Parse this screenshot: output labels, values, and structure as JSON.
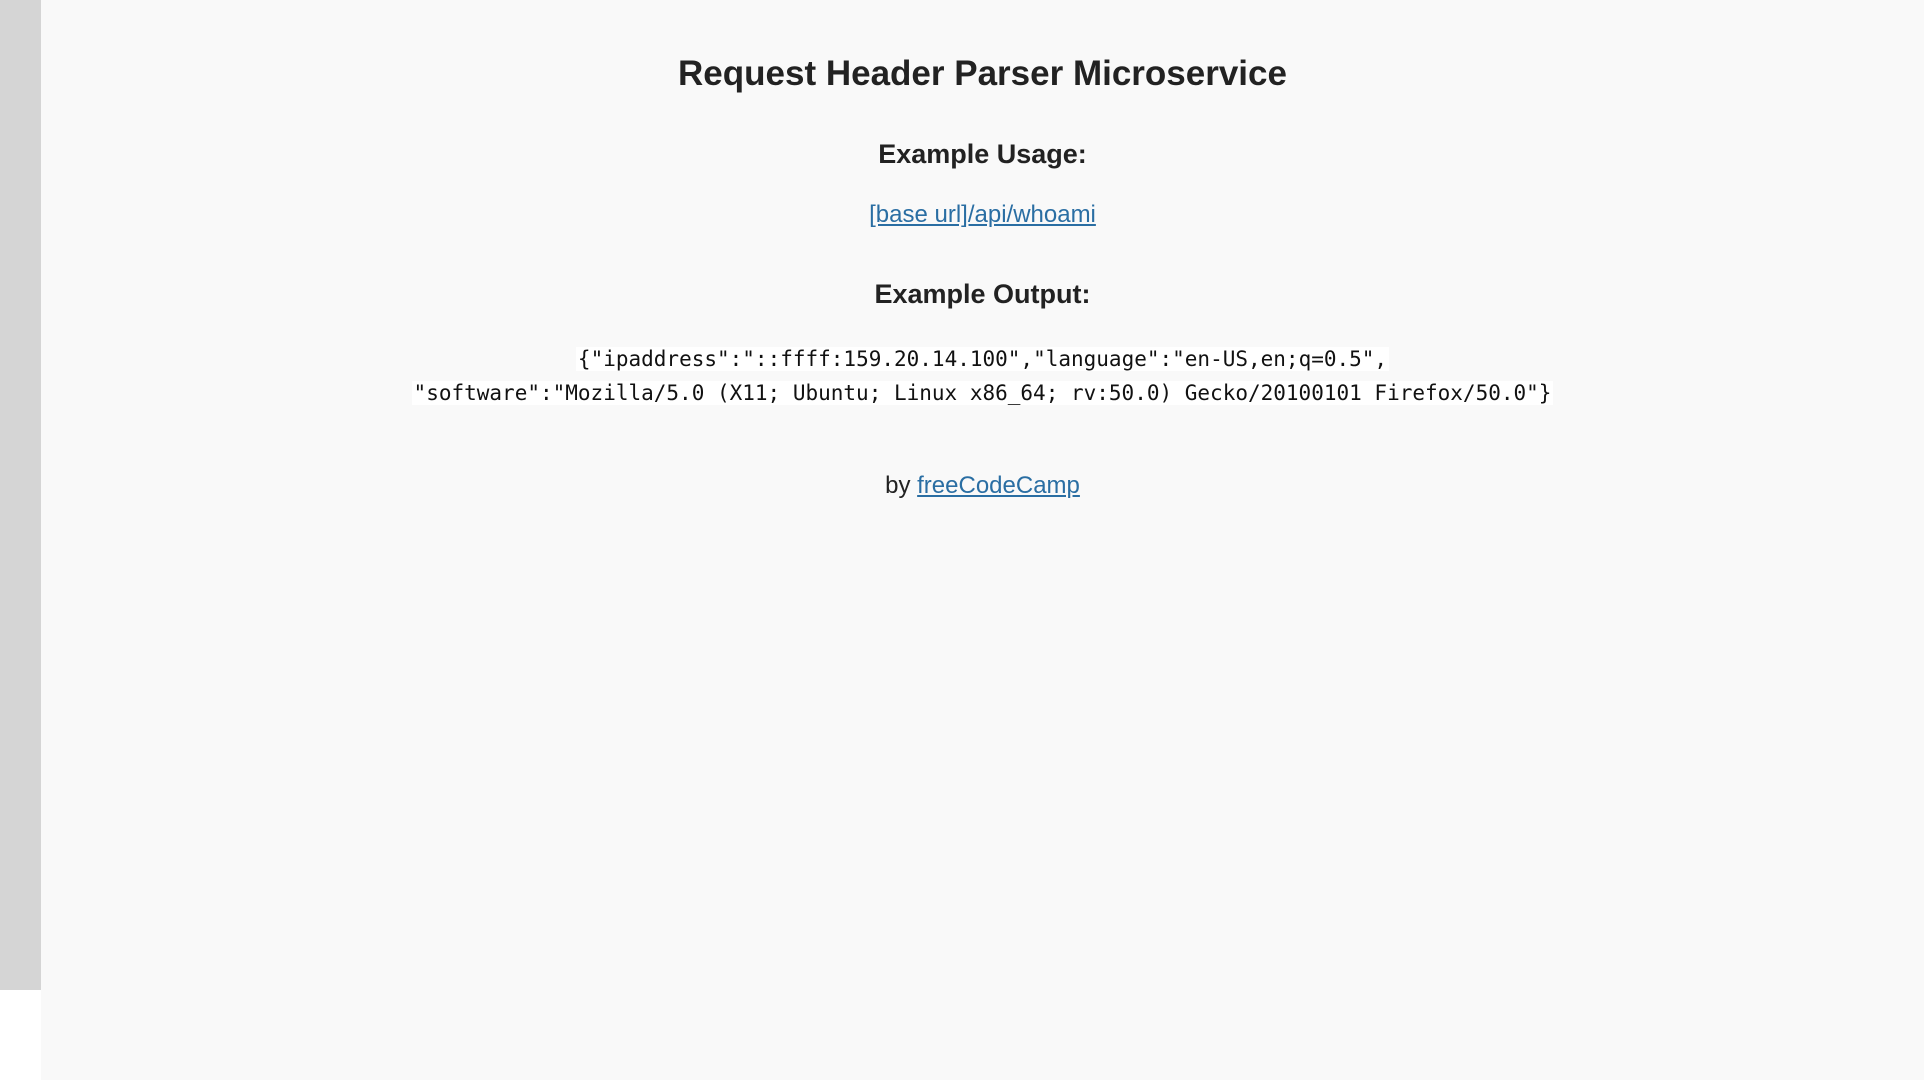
{
  "page": {
    "title": "Request Header Parser Microservice",
    "usage_heading": "Example Usage:",
    "usage_link": "[base url]/api/whoami",
    "output_heading": "Example Output:",
    "output_line1": "{\"ipaddress\":\"::ffff:159.20.14.100\",\"language\":\"en-US,en;q=0.5\",",
    "output_line2": "\"software\":\"Mozilla/5.0 (X11; Ubuntu; Linux x86_64; rv:50.0) Gecko/20100101 Firefox/50.0\"}",
    "credit_prefix": "by",
    "credit_link": "freeCodeCamp"
  },
  "colors": {
    "link": "#2a6ea3",
    "background": "#f9f9f9",
    "side_strip": "#d5d5d5"
  }
}
